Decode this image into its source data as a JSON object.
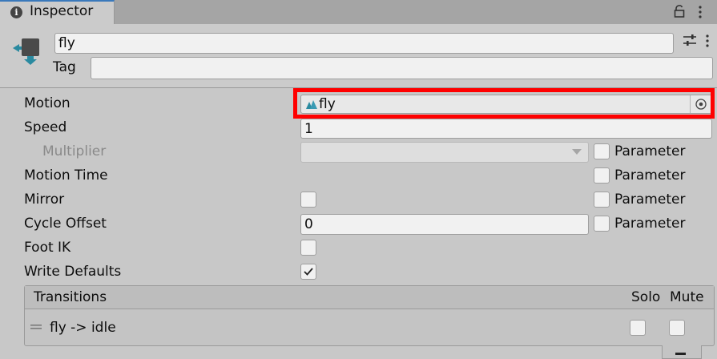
{
  "tab": {
    "title": "Inspector",
    "icon": "info-icon"
  },
  "header": {
    "object_name": "fly",
    "tag_label": "Tag",
    "tag_value": ""
  },
  "properties": {
    "motion": {
      "label": "Motion",
      "value": "fly"
    },
    "speed": {
      "label": "Speed",
      "value": "1"
    },
    "multiplier": {
      "label": "Multiplier",
      "value": ""
    },
    "motion_time": {
      "label": "Motion Time"
    },
    "mirror": {
      "label": "Mirror",
      "checked": false
    },
    "cycle_offset": {
      "label": "Cycle Offset",
      "value": "0"
    },
    "foot_ik": {
      "label": "Foot IK",
      "checked": false
    },
    "write_defaults": {
      "label": "Write Defaults",
      "checked": true
    }
  },
  "parameter_label": "Parameter",
  "transitions": {
    "header": "Transitions",
    "solo_label": "Solo",
    "mute_label": "Mute",
    "items": [
      {
        "name": "fly -> idle",
        "solo": false,
        "mute": false
      }
    ]
  },
  "colors": {
    "highlight": "#ff0000",
    "panel_bg": "#c8c8c8",
    "accent": "#3a79bb"
  }
}
